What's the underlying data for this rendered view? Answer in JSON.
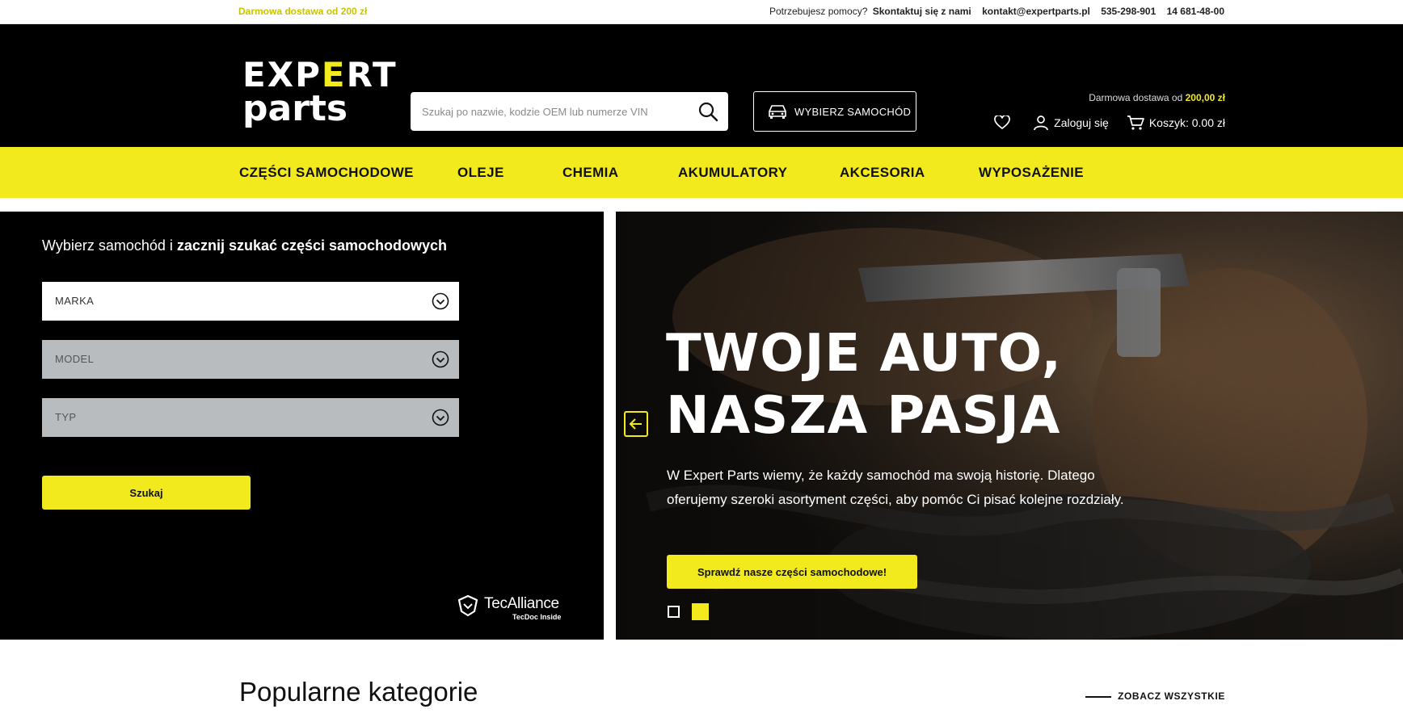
{
  "topbar": {
    "promo": "Darmowa dostawa od 200 zł",
    "help_text": "Potrzebujesz pomocy?",
    "contact_label": "Skontaktuj się z nami",
    "email": "kontakt@expertparts.pl",
    "phone1": "535-298-901",
    "phone2": "14 681-48-00"
  },
  "header": {
    "logo_line1_prefix": "EXP",
    "logo_line1_accent": "E",
    "logo_line1_suffix": "RT",
    "logo_line2": "parts",
    "search_placeholder": "Szukaj po nazwie, kodzie OEM lub numerze VIN",
    "search_icon": "search-icon",
    "car_button_label": "WYBIERZ SAMOCHÓD",
    "shipping_text": "Darmowa dostawa od",
    "shipping_value": "200,00 zł",
    "login_label": "Zaloguj się",
    "cart_label": "Koszyk: 0.00 zł"
  },
  "nav": {
    "items": [
      "CZĘŚCI SAMOCHODOWE",
      "OLEJE",
      "CHEMIA",
      "AKUMULATORY",
      "AKCESORIA",
      "WYPOSAŻENIE"
    ]
  },
  "finder": {
    "title_normal": "Wybierz samochód i",
    "title_bold": "zacznij szukać części samochodowych",
    "make": "MARKA",
    "model": "MODEL",
    "type": "TYP",
    "search_button": "Szukaj",
    "partner_name": "TecAlliance",
    "partner_sub": "TecDoc Inside"
  },
  "hero": {
    "heading_line1": "TWOJE AUTO,",
    "heading_line2": "NASZA PASJA",
    "description": "W Expert Parts wiemy, że każdy samochód ma swoją historię. Dlatego oferujemy szeroki asortyment części, aby pomóc Ci pisać kolejne rozdziały.",
    "cta": "Sprawdź nasze części samochodowe!"
  },
  "popular": {
    "title": "Popularne kategorie",
    "see_all": "ZOBACZ WSZYSTKIE"
  },
  "colors": {
    "accent": "#f2ea1c",
    "header_bg": "#000000"
  }
}
